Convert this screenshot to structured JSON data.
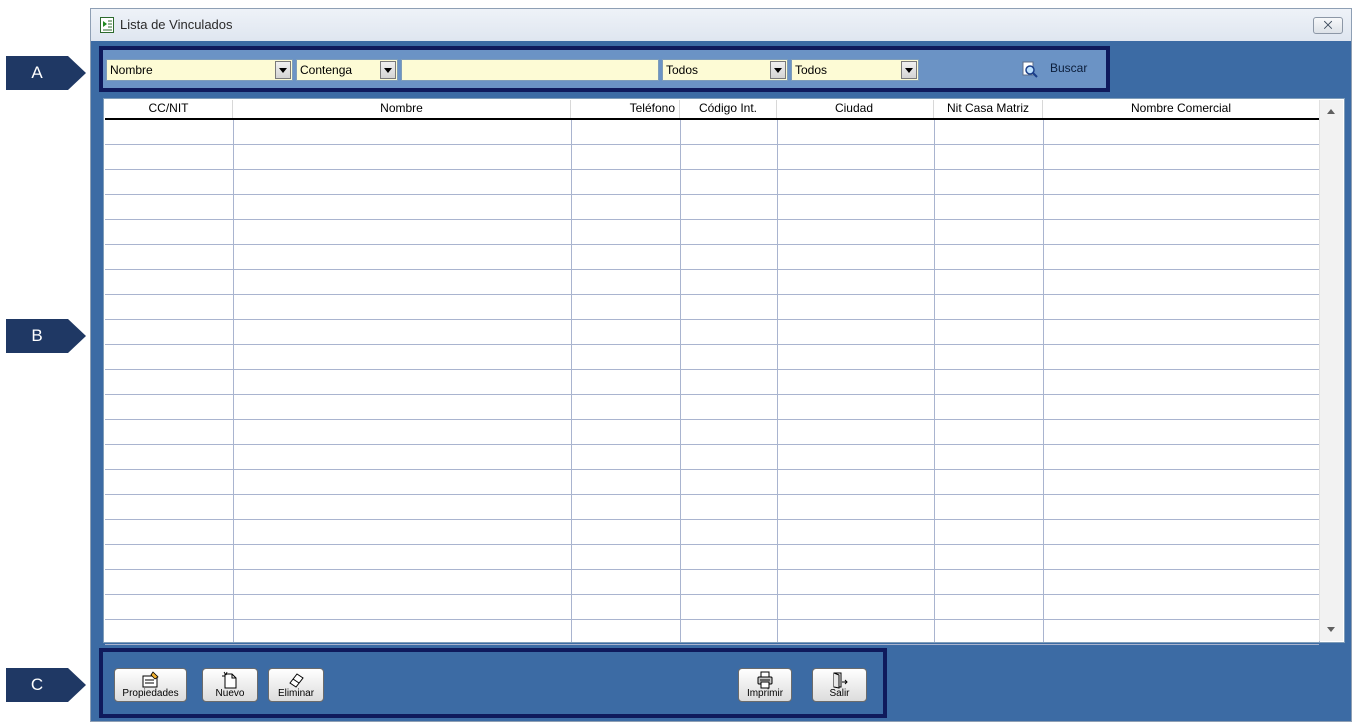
{
  "callouts": [
    "A",
    "B",
    "C"
  ],
  "window": {
    "title": "Lista de Vinculados",
    "close_glyph": "⨉"
  },
  "filters": {
    "field": "Nombre",
    "operator": "Contenga",
    "search_value": "",
    "filter_3": "Todos",
    "filter_4": "Todos",
    "search_label": "Buscar"
  },
  "table": {
    "columns": [
      "CC/NIT",
      "Nombre",
      "Teléfono",
      "Código Int.",
      "Ciudad",
      "Nit Casa Matriz",
      "Nombre Comercial"
    ],
    "rows": []
  },
  "buttons": {
    "properties": "Propiedades",
    "new": "Nuevo",
    "delete": "Eliminar",
    "print": "Imprimir",
    "exit": "Salir"
  },
  "icons": {
    "app": "document-list-icon",
    "search": "magnifier-icon",
    "properties": "properties-icon",
    "new": "new-document-icon",
    "delete": "eraser-icon",
    "print": "printer-icon",
    "exit": "exit-door-icon"
  },
  "colors": {
    "window_bg": "#3c6ba4",
    "toolbar_bg": "#6b93c5",
    "input_bg": "#fdfbd5",
    "callout": "#1f3864",
    "highlight_border": "#0f1a5c"
  }
}
